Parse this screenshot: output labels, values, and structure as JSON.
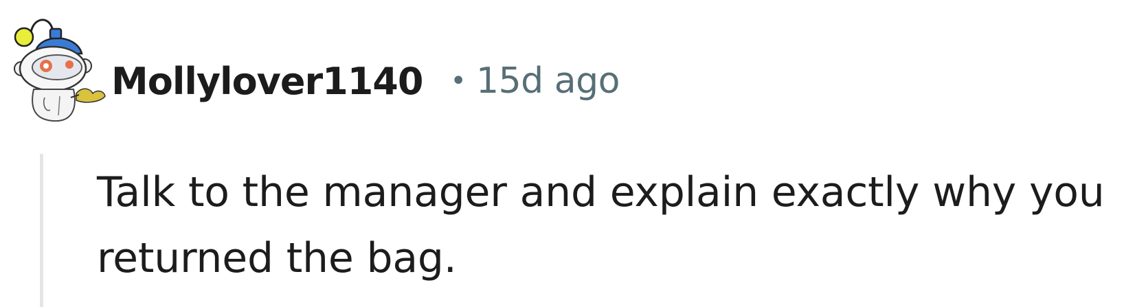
{
  "comment": {
    "author": "Mollylover1140",
    "separator": "•",
    "timestamp": "15d ago",
    "body": "Talk to the manager and explain exactly why you returned the bag."
  },
  "avatar": {
    "icon": "snoo-robot-avatar-icon"
  },
  "colors": {
    "author_text": "#1c1c1c",
    "meta_text": "#576f76",
    "body_text": "#1c1c1c",
    "thread_line": "#e3e5e6",
    "avatar_hat": "#3a7bd5",
    "avatar_antenna_ball": "#e9ee3b",
    "avatar_eyes": "#e8704a"
  }
}
